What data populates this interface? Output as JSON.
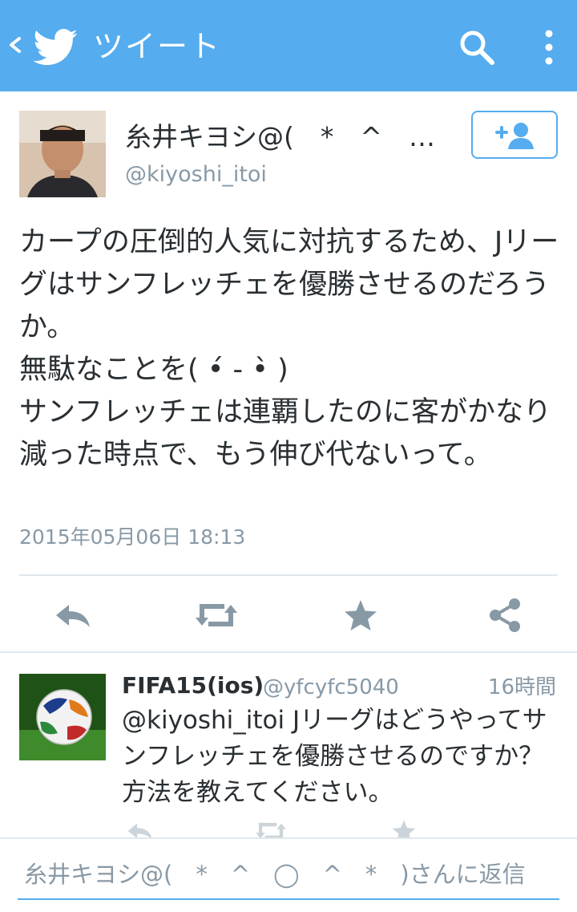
{
  "header": {
    "title": "ツイート",
    "back_icon": "chevron-left-icon",
    "logo_icon": "twitter-bird-icon",
    "search_icon": "search-icon",
    "menu_icon": "more-vertical-icon",
    "background_color": "#55acee"
  },
  "tweet": {
    "author_name": "糸井キヨシ@(　*　^　…",
    "author_handle": "@kiyoshi_itoi",
    "text": "カープの圧倒的人気に対抗するため、Jリーグはサンフレッチェを優勝させるのだろうか。\n無駄なことを( •́ - •̀ )\nサンフレッチェは連覇したのに客がかなり減った時点で、もう伸び代ないって。",
    "timestamp": "2015年05月06日 18:13",
    "follow_icon": "add-user-icon",
    "actions": [
      "reply-icon",
      "retweet-icon",
      "favorite-icon",
      "share-icon"
    ]
  },
  "reply": {
    "name": "FIFA15(ios)",
    "handle": "@yfcyfc5040",
    "time": "16時間",
    "text": "@kiyoshi_itoi Jリーグはどうやってサンフレッチェを優勝させるのですか？方法を教えてください。"
  },
  "composer": {
    "placeholder": "糸井キヨシ@(　*　^　◯　^　*　)さんに返信"
  }
}
